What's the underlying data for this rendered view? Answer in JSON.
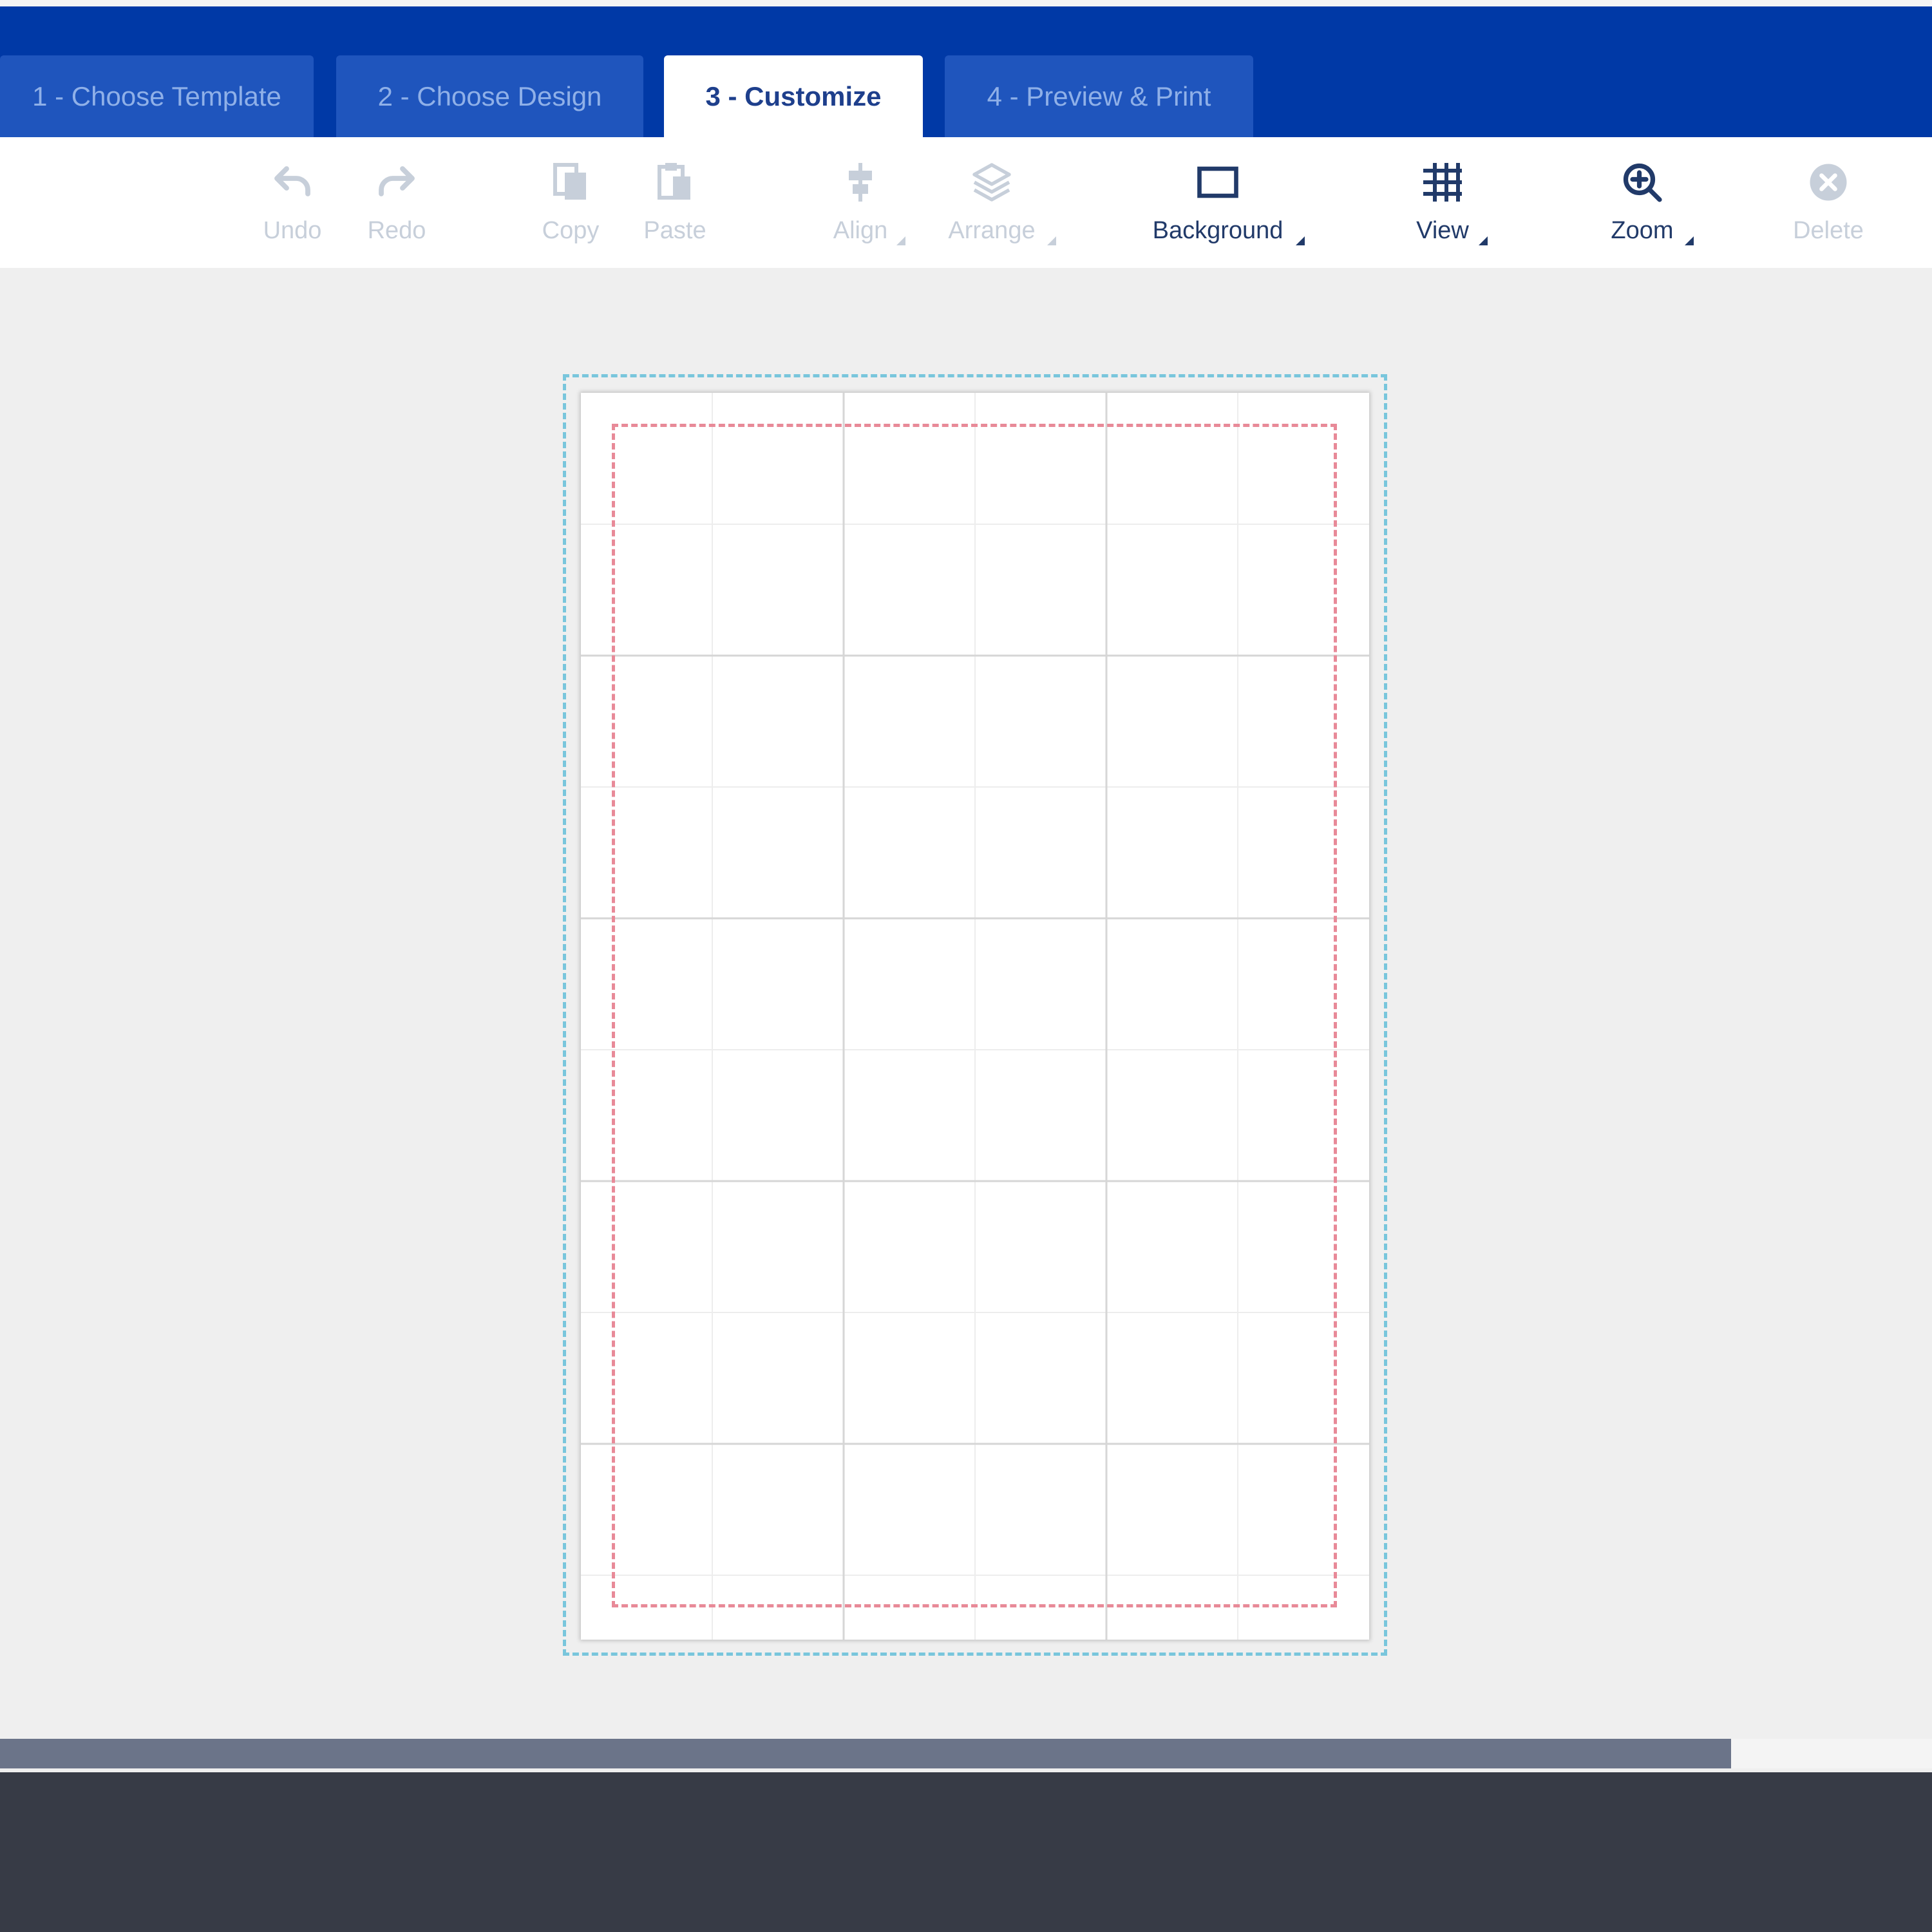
{
  "tabs": [
    {
      "label": "1 - Choose Template",
      "active": false
    },
    {
      "label": "2 - Choose Design",
      "active": false
    },
    {
      "label": "3 - Customize",
      "active": true
    },
    {
      "label": "4 - Preview & Print",
      "active": false
    }
  ],
  "toolbar": {
    "undo": {
      "label": "Undo",
      "icon": "undo-icon",
      "enabled": false
    },
    "redo": {
      "label": "Redo",
      "icon": "redo-icon",
      "enabled": false
    },
    "copy": {
      "label": "Copy",
      "icon": "copy-icon",
      "enabled": false
    },
    "paste": {
      "label": "Paste",
      "icon": "paste-icon",
      "enabled": false
    },
    "align": {
      "label": "Align",
      "icon": "align-icon",
      "enabled": false
    },
    "arrange": {
      "label": "Arrange",
      "icon": "layers-icon",
      "enabled": false
    },
    "background": {
      "label": "Background",
      "icon": "rectangle-icon",
      "enabled": true
    },
    "view": {
      "label": "View",
      "icon": "grid-icon",
      "enabled": true
    },
    "zoom": {
      "label": "Zoom",
      "icon": "zoom-in-icon",
      "enabled": true
    },
    "delete": {
      "label": "Delete",
      "icon": "delete-icon",
      "enabled": false
    }
  },
  "colors": {
    "header": "#0039a6",
    "tab_inactive": "#1f55bd",
    "tab_active_text": "#1e3f8c",
    "toolbar_enabled": "#213a69",
    "toolbar_disabled": "#c7cfda",
    "bleed_line": "#79c6dc",
    "safe_line": "#e88a98",
    "footer": "#373b46"
  }
}
